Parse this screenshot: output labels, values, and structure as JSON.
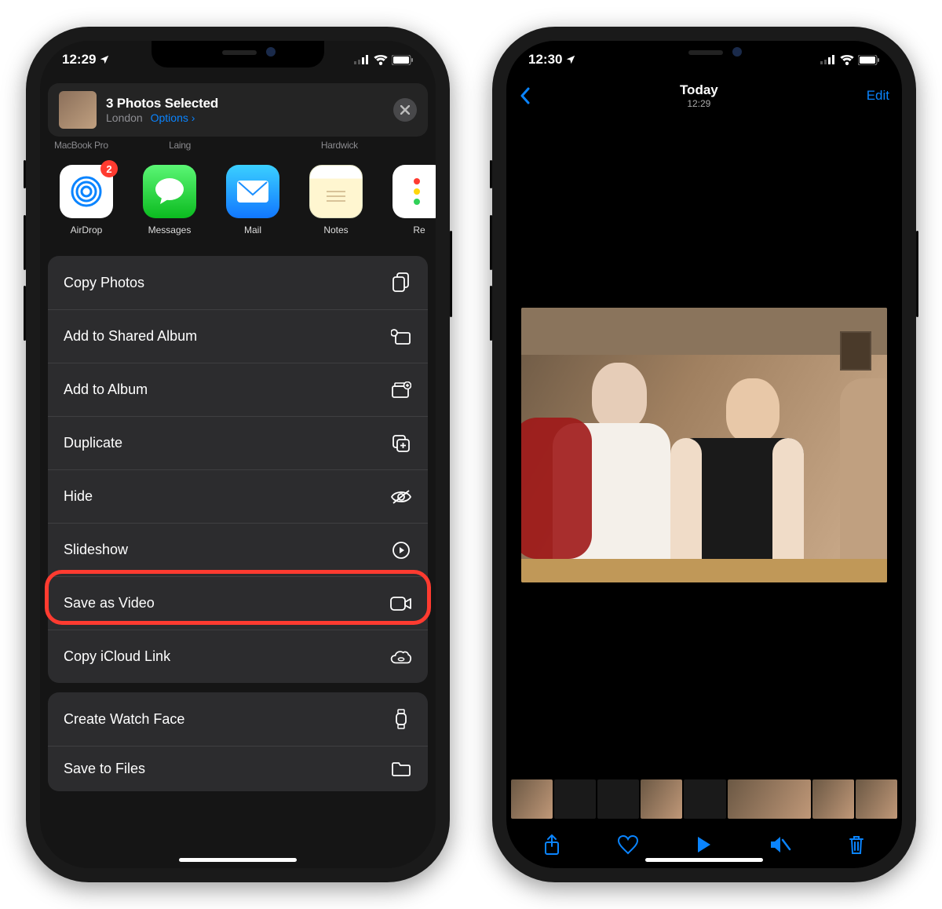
{
  "phone1": {
    "status_time": "12:29",
    "share": {
      "title": "3 Photos Selected",
      "location": "London",
      "options_label": "Options"
    },
    "airdrop_targets": [
      "MacBook Pro",
      "Laing",
      "Hardwick"
    ],
    "apps": [
      {
        "label": "AirDrop",
        "badge": "2"
      },
      {
        "label": "Messages"
      },
      {
        "label": "Mail"
      },
      {
        "label": "Notes"
      },
      {
        "label": "Re"
      }
    ],
    "actions1": [
      {
        "label": "Copy Photos",
        "icon": "copy"
      },
      {
        "label": "Add to Shared Album",
        "icon": "shared-album"
      },
      {
        "label": "Add to Album",
        "icon": "album-add"
      },
      {
        "label": "Duplicate",
        "icon": "duplicate"
      },
      {
        "label": "Hide",
        "icon": "hide"
      },
      {
        "label": "Slideshow",
        "icon": "play-circle"
      },
      {
        "label": "Save as Video",
        "icon": "video",
        "highlighted": true
      },
      {
        "label": "Copy iCloud Link",
        "icon": "cloud-link"
      }
    ],
    "actions2": [
      {
        "label": "Create Watch Face",
        "icon": "watch"
      },
      {
        "label": "Save to Files",
        "icon": "folder"
      }
    ]
  },
  "phone2": {
    "status_time": "12:30",
    "nav": {
      "title": "Today",
      "subtitle": "12:29",
      "edit": "Edit"
    },
    "toolbar": [
      "share",
      "favorite",
      "play",
      "mute",
      "trash"
    ]
  }
}
